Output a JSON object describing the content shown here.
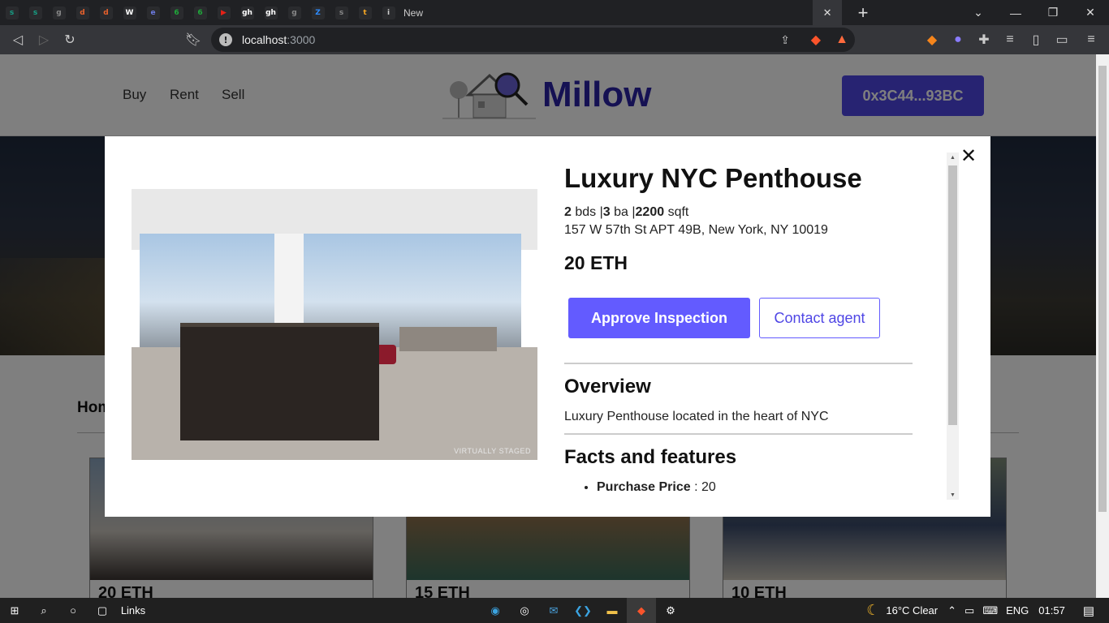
{
  "browser": {
    "tabs": [
      {
        "icon": "s",
        "color": "#16a085"
      },
      {
        "icon": "s",
        "color": "#16a085"
      },
      {
        "icon": "g",
        "color": "#888888"
      },
      {
        "icon": "d",
        "color": "#e8612c"
      },
      {
        "icon": "d",
        "color": "#e8612c"
      },
      {
        "icon": "W",
        "color": "#ffffff"
      },
      {
        "icon": "e",
        "color": "#6c7ae0"
      },
      {
        "icon": "6",
        "color": "#1fa83a"
      },
      {
        "icon": "6",
        "color": "#1fa83a"
      },
      {
        "icon": "▶",
        "color": "#e62117"
      },
      {
        "icon": "gh",
        "color": "#ffffff"
      },
      {
        "icon": "gh",
        "color": "#ffffff"
      },
      {
        "icon": "g",
        "color": "#888888"
      },
      {
        "icon": "Z",
        "color": "#2d8cff"
      },
      {
        "icon": "s",
        "color": "#888888"
      },
      {
        "icon": "t",
        "color": "#f5a623"
      },
      {
        "icon": "i",
        "color": "#cccccc"
      }
    ],
    "tab_text": "New",
    "address": {
      "host": "localhost",
      "port": ":3000"
    }
  },
  "page": {
    "nav": {
      "buy": "Buy",
      "rent": "Rent",
      "sell": "Sell"
    },
    "brand": "Millow",
    "wallet": "0x3C44...93BC",
    "homes_title": "Hom",
    "cards": [
      {
        "price": "20 ETH"
      },
      {
        "price": "15 ETH"
      },
      {
        "price": "10 ETH"
      }
    ]
  },
  "modal": {
    "title": "Luxury NYC Penthouse",
    "beds": "2",
    "beds_label": "bds",
    "baths": "3",
    "baths_label": "ba",
    "sqft": "2200",
    "sqft_label": "sqft",
    "address": "157 W 57th St APT 49B, New York, NY 10019",
    "price": "20 ETH",
    "approve_label": "Approve Inspection",
    "contact_label": "Contact agent",
    "overview_heading": "Overview",
    "overview_text": "Luxury Penthouse located in the heart of NYC",
    "facts_heading": "Facts and features",
    "facts": [
      {
        "label": "Purchase Price",
        "value": "20"
      }
    ],
    "close": "✕",
    "watermark": "VIRTUALLY STAGED"
  },
  "taskbar": {
    "links": "Links",
    "weather": "16°C  Clear",
    "lang": "ENG",
    "time": "01:57"
  }
}
